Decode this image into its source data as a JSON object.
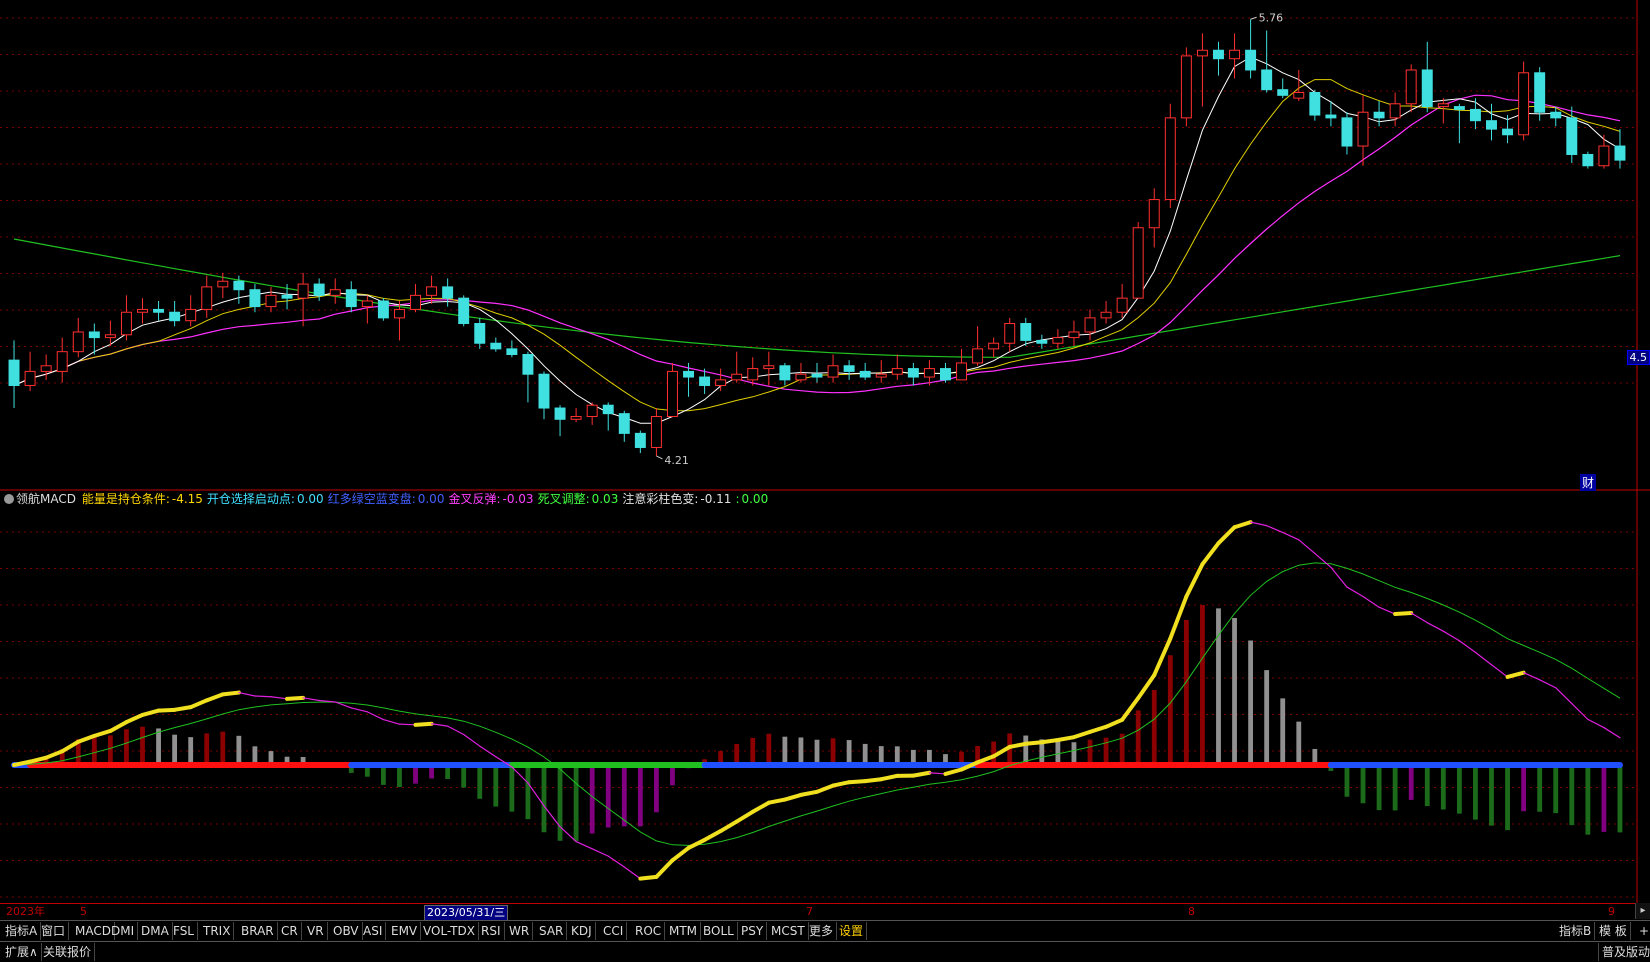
{
  "chart_data": {
    "type": "candlestick",
    "price_annotations": {
      "high": "5.76",
      "low": "4.21"
    },
    "ma_colors": {
      "ma_short": "#ffffff",
      "ma_mid": "#e0d000",
      "ma_long": "#ff30ff",
      "ma_xlong": "#20c020"
    },
    "candles": [
      [
        4.55,
        4.46,
        4.62,
        4.38
      ],
      [
        4.46,
        4.51,
        4.58,
        4.44
      ],
      [
        4.51,
        4.53,
        4.57,
        4.48
      ],
      [
        4.51,
        4.58,
        4.63,
        4.47
      ],
      [
        4.58,
        4.65,
        4.7,
        4.56
      ],
      [
        4.65,
        4.63,
        4.68,
        4.57
      ],
      [
        4.63,
        4.64,
        4.69,
        4.6
      ],
      [
        4.64,
        4.72,
        4.78,
        4.62
      ],
      [
        4.72,
        4.73,
        4.77,
        4.68
      ],
      [
        4.73,
        4.72,
        4.76,
        4.69
      ],
      [
        4.72,
        4.69,
        4.76,
        4.67
      ],
      [
        4.69,
        4.73,
        4.78,
        4.67
      ],
      [
        4.73,
        4.81,
        4.85,
        4.7
      ],
      [
        4.81,
        4.83,
        4.86,
        4.77
      ],
      [
        4.83,
        4.8,
        4.85,
        4.75
      ],
      [
        4.8,
        4.74,
        4.82,
        4.72
      ],
      [
        4.74,
        4.78,
        4.81,
        4.72
      ],
      [
        4.78,
        4.77,
        4.82,
        4.73
      ],
      [
        4.77,
        4.82,
        4.86,
        4.67
      ],
      [
        4.82,
        4.78,
        4.84,
        4.76
      ],
      [
        4.78,
        4.8,
        4.84,
        4.75
      ],
      [
        4.8,
        4.74,
        4.83,
        4.72
      ],
      [
        4.74,
        4.76,
        4.78,
        4.68
      ],
      [
        4.76,
        4.7,
        4.77,
        4.69
      ],
      [
        4.7,
        4.73,
        4.76,
        4.62
      ],
      [
        4.73,
        4.78,
        4.82,
        4.72
      ],
      [
        4.78,
        4.81,
        4.85,
        4.75
      ],
      [
        4.81,
        4.77,
        4.84,
        4.74
      ],
      [
        4.77,
        4.68,
        4.78,
        4.67
      ],
      [
        4.68,
        4.61,
        4.7,
        4.59
      ],
      [
        4.61,
        4.59,
        4.63,
        4.58
      ],
      [
        4.59,
        4.57,
        4.62,
        4.56
      ],
      [
        4.57,
        4.5,
        4.58,
        4.4
      ],
      [
        4.5,
        4.38,
        4.51,
        4.34
      ],
      [
        4.38,
        4.34,
        4.39,
        4.28
      ],
      [
        4.34,
        4.35,
        4.38,
        4.33
      ],
      [
        4.35,
        4.39,
        4.4,
        4.32
      ],
      [
        4.39,
        4.36,
        4.4,
        4.3
      ],
      [
        4.36,
        4.29,
        4.37,
        4.26
      ],
      [
        4.29,
        4.24,
        4.3,
        4.22
      ],
      [
        4.24,
        4.35,
        4.38,
        4.21
      ],
      [
        4.35,
        4.51,
        4.54,
        4.35
      ],
      [
        4.51,
        4.49,
        4.54,
        4.42
      ],
      [
        4.49,
        4.46,
        4.52,
        4.43
      ],
      [
        4.46,
        4.48,
        4.52,
        4.44
      ],
      [
        4.48,
        4.5,
        4.58,
        4.47
      ],
      [
        4.48,
        4.52,
        4.56,
        4.46
      ],
      [
        4.52,
        4.53,
        4.58,
        4.46
      ],
      [
        4.53,
        4.48,
        4.54,
        4.46
      ],
      [
        4.48,
        4.5,
        4.54,
        4.47
      ],
      [
        4.5,
        4.49,
        4.54,
        4.47
      ],
      [
        4.49,
        4.53,
        4.57,
        4.47
      ],
      [
        4.53,
        4.51,
        4.55,
        4.48
      ],
      [
        4.51,
        4.49,
        4.54,
        4.48
      ],
      [
        4.49,
        4.5,
        4.55,
        4.47
      ],
      [
        4.5,
        4.52,
        4.57,
        4.48
      ],
      [
        4.52,
        4.49,
        4.54,
        4.46
      ],
      [
        4.49,
        4.52,
        4.55,
        4.46
      ],
      [
        4.52,
        4.48,
        4.54,
        4.47
      ],
      [
        4.48,
        4.54,
        4.59,
        4.48
      ],
      [
        4.54,
        4.59,
        4.67,
        4.53
      ],
      [
        4.59,
        4.61,
        4.63,
        4.56
      ],
      [
        4.61,
        4.68,
        4.7,
        4.58
      ],
      [
        4.68,
        4.62,
        4.7,
        4.6
      ],
      [
        4.62,
        4.61,
        4.64,
        4.59
      ],
      [
        4.61,
        4.63,
        4.66,
        4.59
      ],
      [
        4.63,
        4.65,
        4.69,
        4.6
      ],
      [
        4.65,
        4.7,
        4.73,
        4.62
      ],
      [
        4.7,
        4.72,
        4.76,
        4.68
      ],
      [
        4.72,
        4.77,
        4.82,
        4.7
      ],
      [
        4.77,
        5.02,
        5.04,
        4.78
      ],
      [
        5.02,
        5.12,
        5.16,
        4.95
      ],
      [
        5.12,
        5.41,
        5.46,
        5.09
      ],
      [
        5.41,
        5.63,
        5.66,
        5.38
      ],
      [
        5.63,
        5.65,
        5.71,
        5.45
      ],
      [
        5.65,
        5.62,
        5.68,
        5.56
      ],
      [
        5.62,
        5.65,
        5.71,
        5.55
      ],
      [
        5.65,
        5.58,
        5.76,
        5.55
      ],
      [
        5.58,
        5.51,
        5.72,
        5.5
      ],
      [
        5.51,
        5.49,
        5.55,
        5.48
      ],
      [
        5.48,
        5.5,
        5.58,
        5.47
      ],
      [
        5.5,
        5.42,
        5.51,
        5.4
      ],
      [
        5.42,
        5.41,
        5.47,
        5.38
      ],
      [
        5.41,
        5.31,
        5.43,
        5.28
      ],
      [
        5.31,
        5.43,
        5.49,
        5.24
      ],
      [
        5.43,
        5.41,
        5.47,
        5.38
      ],
      [
        5.41,
        5.46,
        5.5,
        5.38
      ],
      [
        5.46,
        5.58,
        5.6,
        5.43
      ],
      [
        5.58,
        5.45,
        5.68,
        5.43
      ],
      [
        5.45,
        5.46,
        5.48,
        5.39
      ],
      [
        5.45,
        5.44,
        5.46,
        5.32
      ],
      [
        5.44,
        5.4,
        5.48,
        5.37
      ],
      [
        5.4,
        5.37,
        5.46,
        5.33
      ],
      [
        5.37,
        5.35,
        5.42,
        5.32
      ],
      [
        5.35,
        5.57,
        5.61,
        5.33
      ],
      [
        5.57,
        5.43,
        5.59,
        5.4
      ],
      [
        5.43,
        5.41,
        5.45,
        5.38
      ],
      [
        5.41,
        5.28,
        5.45,
        5.25
      ],
      [
        5.28,
        5.24,
        5.29,
        5.23
      ],
      [
        5.24,
        5.31,
        5.35,
        5.23
      ],
      [
        5.31,
        5.26,
        5.37,
        5.23
      ]
    ]
  },
  "indicator": {
    "name": "领航MACD",
    "items": [
      {
        "label": "能量是持仓条件:",
        "value": "-4.15",
        "color": "#ffd700"
      },
      {
        "label": "开仓选择启动点:",
        "value": "0.00",
        "color": "#40e0ff"
      },
      {
        "label": "红多绿空蓝变盘:",
        "value": "0.00",
        "color": "#4060ff"
      },
      {
        "label": "金叉反弹:",
        "value": "-0.03",
        "color": "#ff40ff"
      },
      {
        "label": "死叉调整:",
        "value": "0.03",
        "color": "#40ff40"
      },
      {
        "label": "注意彩柱色变:",
        "value": "-0.11",
        "color": "#e0e0e0"
      },
      {
        "label": ":",
        "value": "0.00",
        "color": "#40ff40"
      }
    ]
  },
  "date_axis": {
    "labels": [
      "2023年",
      "5",
      "2023/05/31/三",
      "7",
      "8",
      "9"
    ]
  },
  "price_tag": "4.5",
  "cai_tag": "财",
  "toolbar": {
    "items": [
      "指标A",
      "窗口",
      "MACD",
      "DMI",
      "DMA",
      "FSL",
      "TRIX",
      "BRAR",
      "CR",
      "VR",
      "OBV",
      "ASI",
      "EMV",
      "VOL-TDX",
      "RSI",
      "WR",
      "SAR",
      "KDJ",
      "CCI",
      "ROC",
      "MTM",
      "BOLL",
      "PSY",
      "MCST",
      "更多",
      "设置"
    ],
    "right": [
      "指标B",
      "模 板",
      "+"
    ]
  },
  "statusbar": {
    "left": [
      "扩展∧",
      "关联报价"
    ],
    "right": "普及版动"
  }
}
